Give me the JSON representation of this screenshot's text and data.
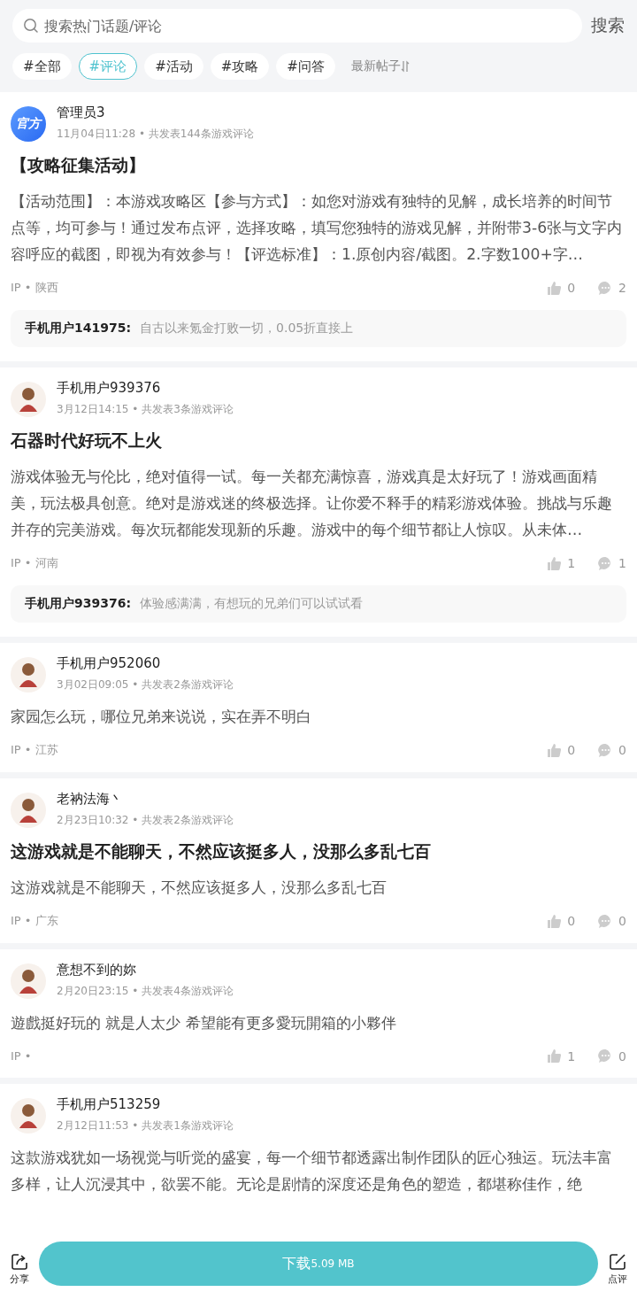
{
  "search": {
    "placeholder": "搜索热门话题/评论",
    "button": "搜索"
  },
  "tabs": [
    {
      "label": "#全部",
      "selected": false
    },
    {
      "label": "#评论",
      "selected": true
    },
    {
      "label": "#活动",
      "selected": false
    },
    {
      "label": "#攻略",
      "selected": false
    },
    {
      "label": "#问答",
      "selected": false
    }
  ],
  "sort": "最新帖子",
  "posts": [
    {
      "user": "管理员3",
      "avatar": {
        "kind": "official",
        "label": "官方"
      },
      "meta": "11月04日11:28 • 共发表144条游戏评论",
      "title": "【攻略征集活动】",
      "body": "【活动范围】：本游戏攻略区【参与方式】：如您对游戏有独特的见解，成长培养的时间节点等，均可参与！通过发布点评，选择攻略，填写您独特的游戏见解，并附带3-6张与文字内容呼应的截图，即视为有效参与！【评选标准】：1.原创内容/截图。2.字数100+字…",
      "location": "IP • 陕西",
      "likes": "0",
      "comments": "2",
      "reply": {
        "user": "手机用户141975:",
        "text": "自古以来氪金打败一切，0.05折直接上"
      }
    },
    {
      "user": "手机用户939376",
      "avatar": {
        "kind": "figure"
      },
      "meta": "3月12日14:15 • 共发表3条游戏评论",
      "title": "石器时代好玩不上火",
      "body": "游戏体验无与伦比，绝对值得一试。每一关都充满惊喜，游戏真是太好玩了！游戏画面精美，玩法极具创意。绝对是游戏迷的终极选择。让你爱不释手的精彩游戏体验。挑战与乐趣并存的完美游戏。每次玩都能发现新的乐趣。游戏中的每个细节都让人惊叹。从未体…",
      "location": "IP • 河南",
      "likes": "1",
      "comments": "1",
      "reply": {
        "user": "手机用户939376:",
        "text": "体验感满满，有想玩的兄弟们可以试试看"
      }
    },
    {
      "user": "手机用户952060",
      "avatar": {
        "kind": "figure"
      },
      "meta": "3月02日09:05 • 共发表2条游戏评论",
      "body": "家园怎么玩，哪位兄弟来说说，实在弄不明白",
      "location": "IP • 江苏",
      "likes": "0",
      "comments": "0"
    },
    {
      "user": "老衲法海丶",
      "avatar": {
        "kind": "figure"
      },
      "meta": "2月23日10:32 • 共发表2条游戏评论",
      "title": "这游戏就是不能聊天，不然应该挺多人，没那么多乱七百",
      "body": "这游戏就是不能聊天，不然应该挺多人，没那么多乱七百",
      "location": "IP • 广东",
      "likes": "0",
      "comments": "0"
    },
    {
      "user": "意想不到的妳",
      "avatar": {
        "kind": "figure"
      },
      "meta": "2月20日23:15 • 共发表4条游戏评论",
      "body": "遊戲挺好玩的 就是人太少 希望能有更多愛玩開箱的小夥伴",
      "location": "IP •",
      "likes": "1",
      "comments": "0"
    },
    {
      "user": "手机用户513259",
      "avatar": {
        "kind": "figure"
      },
      "meta": "2月12日11:53 • 共发表1条游戏评论",
      "body": "这款游戏犹如一场视觉与听觉的盛宴，每一个细节都透露出制作团队的匠心独运。玩法丰富多样，让人沉浸其中，欲罢不能。无论是剧情的深度还是角色的塑造，都堪称佳作，绝"
    }
  ],
  "bottom": {
    "share": "分享",
    "download": "下载",
    "size": "5.09 MB",
    "review": "点评"
  }
}
